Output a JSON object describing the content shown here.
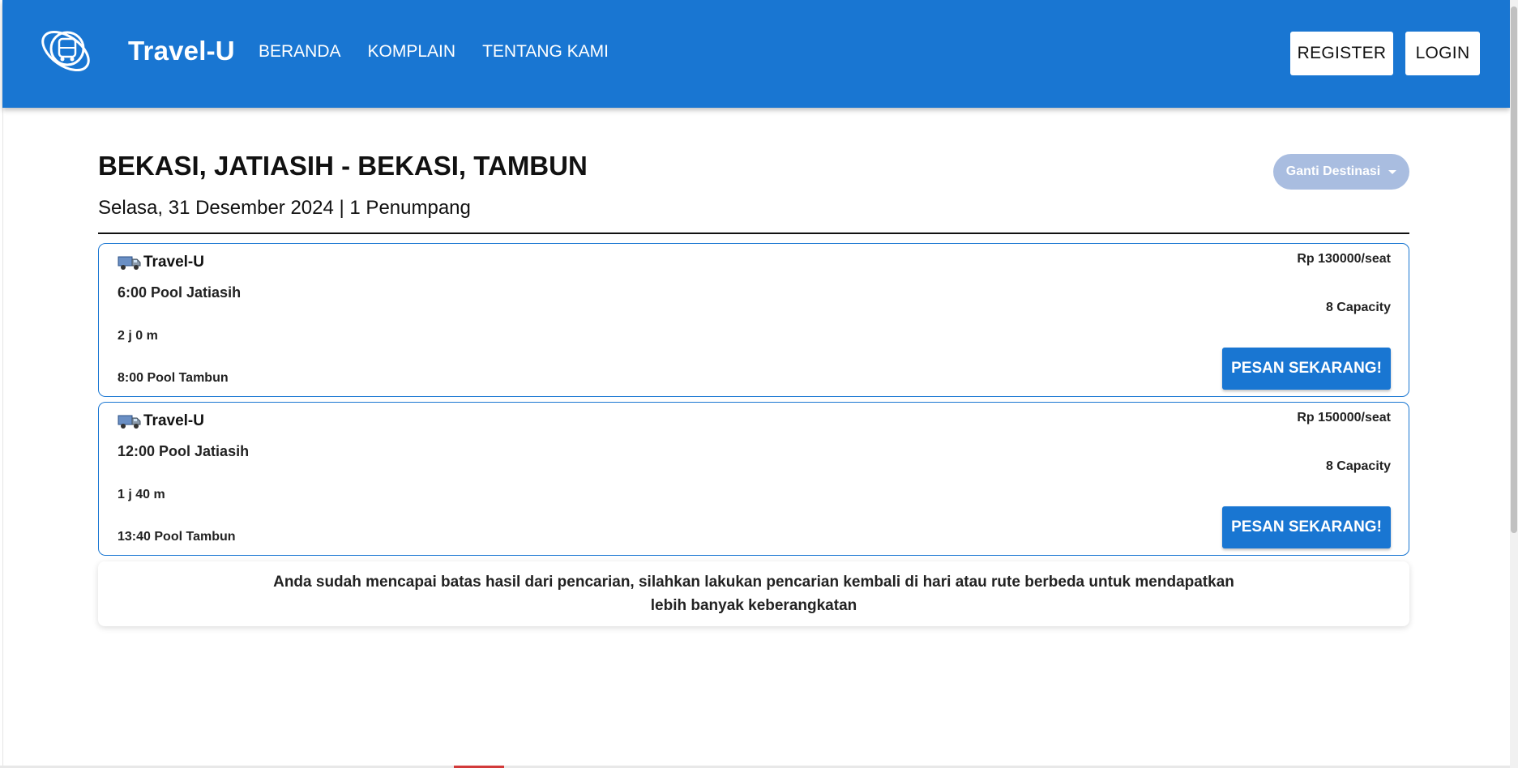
{
  "header": {
    "brand": "Travel-U",
    "nav": [
      "BERANDA",
      "KOMPLAIN",
      "TENTANG KAMI"
    ],
    "register_label": "REGISTER",
    "login_label": "LOGIN",
    "bg_color": "#1976d2"
  },
  "search": {
    "route": "BEKASI, JATIASIH - BEKASI, TAMBUN",
    "summary": "Selasa, 31 Desember 2024 | 1 Penumpang",
    "change_destination_label": "Ganti Destinasi"
  },
  "trips": [
    {
      "operator": "Travel-U",
      "departure": "6:00 Pool Jatiasih",
      "duration": "2 j 0 m",
      "arrival": "8:00 Pool Tambun",
      "price": "Rp 130000/seat",
      "capacity": "8 Capacity",
      "book_label": "PESAN SEKARANG!"
    },
    {
      "operator": "Travel-U",
      "departure": "12:00 Pool Jatiasih",
      "duration": "1 j 40 m",
      "arrival": "13:40 Pool Tambun",
      "price": "Rp 150000/seat",
      "capacity": "8 Capacity",
      "book_label": "PESAN SEKARANG!"
    }
  ],
  "notice": "Anda sudah mencapai batas hasil dari pencarian, silahkan lakukan pencarian kembali di hari atau rute berbeda untuk mendapatkan lebih banyak keberangkatan",
  "icons": {
    "logo": "globe-bus-logo-icon",
    "operator": "truck-icon",
    "dropdown": "caret-down-icon"
  }
}
